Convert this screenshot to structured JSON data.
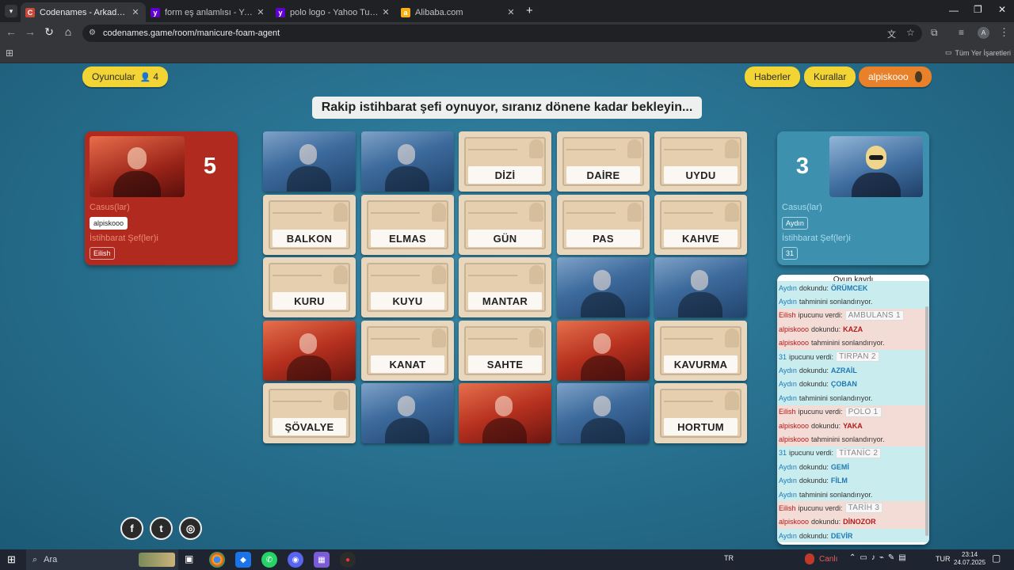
{
  "browser": {
    "tabs": [
      {
        "title": "Codenames - Arkadaşlarınızla ç",
        "icon": "codenames-icon",
        "active": true
      },
      {
        "title": "form eş anlamlısı - Yahoo Turk",
        "icon": "yahoo-icon"
      },
      {
        "title": "polo logo - Yahoo Turkey Aram",
        "icon": "yahoo-icon"
      },
      {
        "title": "Alibaba.com",
        "icon": "alibaba-icon"
      }
    ],
    "url": "codenames.game/room/manicure-foam-agent",
    "bookmarks_label": "Tüm Yer İşaretleri",
    "profile_initial": "A"
  },
  "game": {
    "players_label": "Oyuncular",
    "players_count": "4",
    "news_label": "Haberler",
    "rules_label": "Kurallar",
    "user_label": "alpiskooo",
    "banner": "Rakip istihbarat şefi oynuyor, sıranız dönene kadar bekleyin...",
    "red_team": {
      "score": "5",
      "operatives_label": "Casus(lar)",
      "operatives": [
        "alpiskooo"
      ],
      "spymasters_label": "İstihbarat Şef(ler)i",
      "spymasters": [
        "Eilish"
      ]
    },
    "blue_team": {
      "score": "3",
      "operatives_label": "Casus(lar)",
      "operatives": [
        "Aydın"
      ],
      "spymasters_label": "İstihbarat Şef(ler)i",
      "spymasters": [
        "31"
      ]
    },
    "board": [
      [
        "agent-blue",
        "agent-blue",
        "DİZİ",
        "DAİRE",
        "UYDU"
      ],
      [
        "BALKON",
        "ELMAS",
        "GÜN",
        "PAS",
        "KAHVE"
      ],
      [
        "KURU",
        "KUYU",
        "MANTAR",
        "agent-blue",
        "agent-blue"
      ],
      [
        "agent-red",
        "KANAT",
        "SAHTE",
        "agent-red",
        "KAVURMA"
      ],
      [
        "ŞÖVALYE",
        "agent-blue",
        "agent-red",
        "agent-blue",
        "HORTUM"
      ]
    ],
    "log": {
      "title": "Oyun kaydı",
      "entries": [
        {
          "team": "b",
          "player": "Aydın",
          "action": "dokundu:",
          "word": "ÖRÜMCEK"
        },
        {
          "team": "b",
          "player": "Aydın",
          "action": "tahminini sonlandırıyor."
        },
        {
          "team": "r",
          "player": "Eilish",
          "action": "ipucunu verdi:",
          "clue": "AMBULANS 1"
        },
        {
          "team": "r",
          "player": "alpiskooo",
          "action": "dokundu:",
          "word": "KAZA"
        },
        {
          "team": "r",
          "player": "alpiskooo",
          "action": "tahminini sonlandırıyor."
        },
        {
          "team": "b",
          "player": "31",
          "action": "ipucunu verdi:",
          "clue": "TIRPAN 2"
        },
        {
          "team": "b",
          "player": "Aydın",
          "action": "dokundu:",
          "word": "AZRAİL"
        },
        {
          "team": "b",
          "player": "Aydın",
          "action": "dokundu:",
          "word": "ÇOBAN"
        },
        {
          "team": "b",
          "player": "Aydın",
          "action": "tahminini sonlandırıyor."
        },
        {
          "team": "r",
          "player": "Eilish",
          "action": "ipucunu verdi:",
          "clue": "POLO 1"
        },
        {
          "team": "r",
          "player": "alpiskooo",
          "action": "dokundu:",
          "word": "YAKA"
        },
        {
          "team": "r",
          "player": "alpiskooo",
          "action": "tahminini sonlandırıyor."
        },
        {
          "team": "b",
          "player": "31",
          "action": "ipucunu verdi:",
          "clue": "TİTANİC 2"
        },
        {
          "team": "b",
          "player": "Aydın",
          "action": "dokundu:",
          "word": "GEMİ"
        },
        {
          "team": "b",
          "player": "Aydın",
          "action": "dokundu:",
          "word": "FİLM"
        },
        {
          "team": "b",
          "player": "Aydın",
          "action": "tahminini sonlandırıyor."
        },
        {
          "team": "r",
          "player": "Eilish",
          "action": "ipucunu verdi:",
          "clue": "TARİH 3"
        },
        {
          "team": "r",
          "player": "alpiskooo",
          "action": "dokundu:",
          "word": "DİNOZOR"
        },
        {
          "team": "b",
          "player": "Aydın",
          "action": "dokundu:",
          "word": "DEVİR"
        }
      ]
    },
    "social": [
      "facebook-icon",
      "twitter-icon",
      "instagram-icon"
    ]
  },
  "taskbar": {
    "search_placeholder": "Ara",
    "lang": "TR",
    "live_label": "Canlı",
    "keyboard": "TUR",
    "time": "23:14",
    "date": "24.07.2025"
  },
  "colors": {
    "red": "#b3191c",
    "blue": "#1f79b6",
    "yellow": "#f2d534",
    "orange": "#e9802a"
  }
}
